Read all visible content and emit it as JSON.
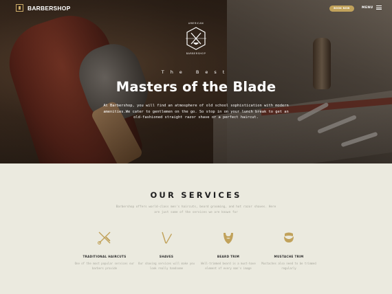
{
  "colors": {
    "accent": "#c1a25b",
    "page_bg": "#ebeadf",
    "title": "#1e1e1e",
    "muted": "#a9a89e"
  },
  "nav": {
    "logo_text": "BARBERSHOP",
    "book_label": "BOOK NOW",
    "menu_label": "MENU"
  },
  "hero": {
    "emblem_top": "AMERICAN",
    "emblem_bottom": "BARBERSHOP",
    "subtitle": "The Best",
    "title": "Masters of the Blade",
    "description": "At Barbershop, you will find an atmosphere of old school sophistication with modern amenities.We cater to gentlemen on the go. So stop in on your lunch break to get an old-fashioned straight razor shave or a perfect haircut."
  },
  "services": {
    "title": "OUR SERVICES",
    "intro": "Barbershop offers world-class men's haircuts, beard grooming, and hot razor shaves. Here are just some of the services we are known for",
    "items": [
      {
        "icon": "scissors-comb-icon",
        "name": "TRADITIONAL HAIRCUTS",
        "desc": "One of the most popular services our barbers provide"
      },
      {
        "icon": "razor-icon",
        "name": "SHAVES",
        "desc": "Our shaving services will make you look really handsome"
      },
      {
        "icon": "beard-icon",
        "name": "BEARD TRIM",
        "desc": "Well-trimmed beard is a must-have element of every man's image"
      },
      {
        "icon": "mustache-icon",
        "name": "MUSTACHE TRIM",
        "desc": "Mustaches also need to be trimmed regularly"
      }
    ]
  }
}
